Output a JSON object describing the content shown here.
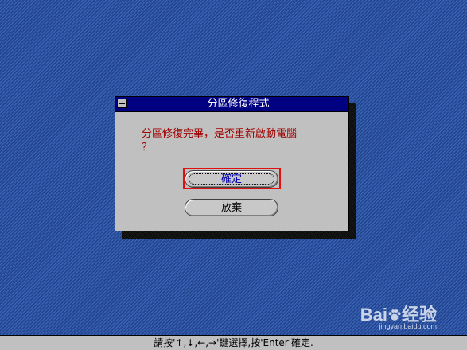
{
  "dialog": {
    "title": "分區修復程式",
    "message_line1": "分區修復完畢，是否重新啟動電腦",
    "message_line2": "？",
    "ok_label": "確定",
    "cancel_label": "放棄"
  },
  "statusbar": {
    "text": "請按'↑,↓,←,→'鍵選擇,按'Enter'確定."
  },
  "watermark": {
    "logo_left": "Bai",
    "logo_right": "经验",
    "url": "jingyan.baidu.com"
  },
  "colors": {
    "desktop": "#2a4f9c",
    "titlebar": "#000080",
    "message": "#a00000",
    "focus_frame": "#e01010"
  }
}
